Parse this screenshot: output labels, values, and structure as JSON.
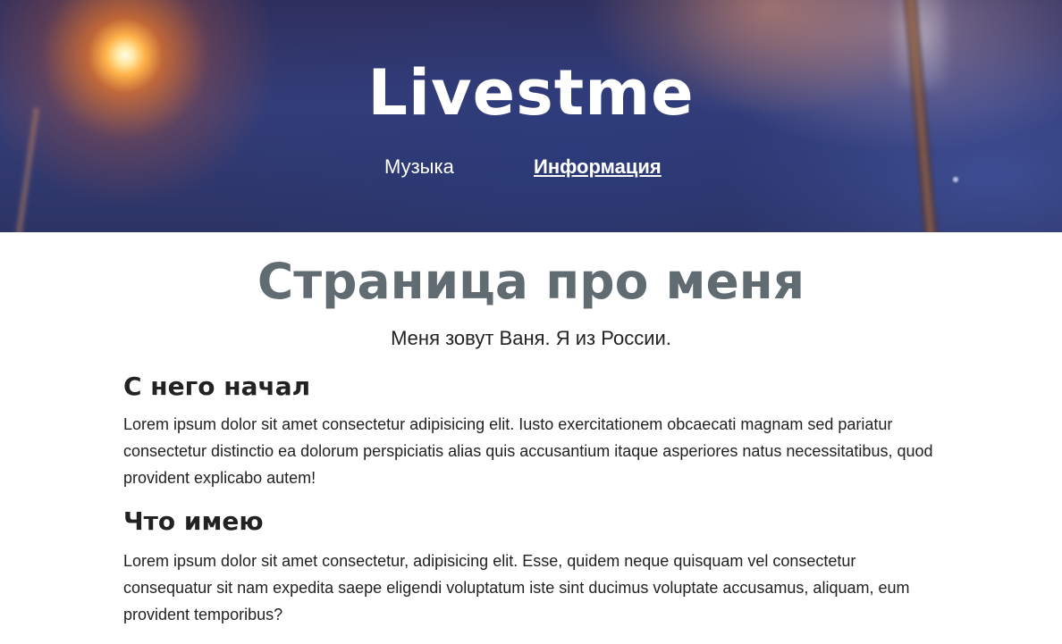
{
  "header": {
    "site_title": "Livestme",
    "nav": [
      {
        "label": "Музыка",
        "active": false
      },
      {
        "label": "Информация",
        "active": true
      }
    ]
  },
  "main": {
    "page_title": "Страница про меня",
    "intro": "Меня зовут Ваня. Я из России.",
    "sections": [
      {
        "heading": "С него начал",
        "text": "Lorem ipsum dolor sit amet consectetur adipisicing elit. Iusto exercitationem obcaecati magnam sed pariatur consectetur distinctio ea dolorum perspiciatis alias quis accusantium itaque asperiores natus necessitatibus, quod provident explicabo autem!"
      },
      {
        "heading": "Что имею",
        "text": "Lorem ipsum dolor sit amet consectetur, adipisicing elit. Esse, quidem neque quisquam vel consectetur consequatur sit nam expedita saepe eligendi voluptatum iste sint ducimus voluptate accusamus, aliquam, eum provident temporibus?"
      }
    ]
  },
  "colors": {
    "page_title": "#616b72",
    "body_text": "#222222",
    "header_text": "#ffffff"
  }
}
